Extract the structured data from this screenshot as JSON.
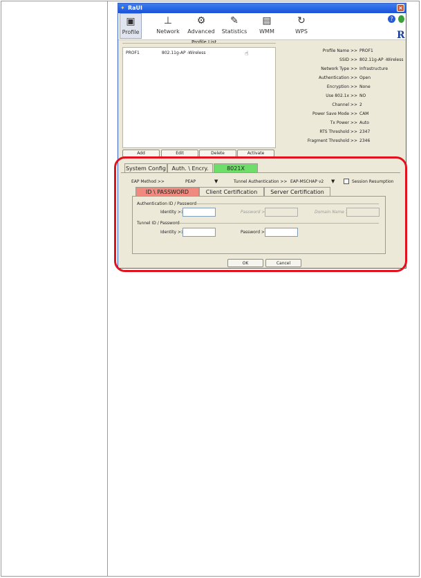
{
  "window": {
    "title": "RaUI",
    "close_glyph": "×"
  },
  "toolbar": {
    "items": [
      {
        "label": "Profile",
        "icon": "profile-icon"
      },
      {
        "label": "Network",
        "icon": "network-icon"
      },
      {
        "label": "Advanced",
        "icon": "advanced-icon"
      },
      {
        "label": "Statistics",
        "icon": "statistics-icon"
      },
      {
        "label": "WMM",
        "icon": "wmm-icon"
      },
      {
        "label": "WPS",
        "icon": "wps-icon"
      }
    ],
    "help_glyph": "?",
    "brand_glyph": "R"
  },
  "profile_list": {
    "label": "Profile List",
    "rows": [
      {
        "name": "PROF1",
        "ssid": "802.11g-AP -Wireless"
      }
    ],
    "buttons": [
      "Add",
      "Edit",
      "Delete",
      "Activate"
    ]
  },
  "profile_info": [
    {
      "key": "Profile Name >>",
      "value": "PROF1"
    },
    {
      "key": "SSID >>",
      "value": "802.11g-AP -Wireless"
    },
    {
      "key": "Network Type >>",
      "value": "Infrastructure"
    },
    {
      "key": "Authentication >>",
      "value": "Open"
    },
    {
      "key": "Encryption >>",
      "value": "None"
    },
    {
      "key": "Use 802.1x >>",
      "value": "NO"
    },
    {
      "key": "Channel >>",
      "value": "2"
    },
    {
      "key": "Power Save Mode >>",
      "value": "CAM"
    },
    {
      "key": "Tx Power >>",
      "value": "Auto"
    },
    {
      "key": "RTS Threshold >>",
      "value": "2347"
    },
    {
      "key": "Fragment Threshold >>",
      "value": "2346"
    }
  ],
  "config_tabs": [
    "System Config",
    "Auth. \\ Encry.",
    "8021X"
  ],
  "eap": {
    "method_label": "EAP Method >>",
    "method_value": "PEAP",
    "tunnel_label": "Tunnel Authentication >>",
    "tunnel_value": "EAP-MSCHAP v2",
    "session_label": "Session Resumption"
  },
  "sub_tabs": [
    "ID \\ PASSWORD",
    "Client Certification",
    "Server Certification"
  ],
  "auth_group": {
    "label": "Authentication ID / Password",
    "identity_label": "Identity >>",
    "password_label": "Password >>",
    "domain_label": "Domain Name >>"
  },
  "tunnel_group": {
    "label": "Tunnel ID / Password",
    "identity_label": "Identity >>",
    "password_label": "Password >>"
  },
  "dialog_buttons": {
    "ok": "OK",
    "cancel": "Cancel"
  },
  "highlight_color": "#e0121e"
}
